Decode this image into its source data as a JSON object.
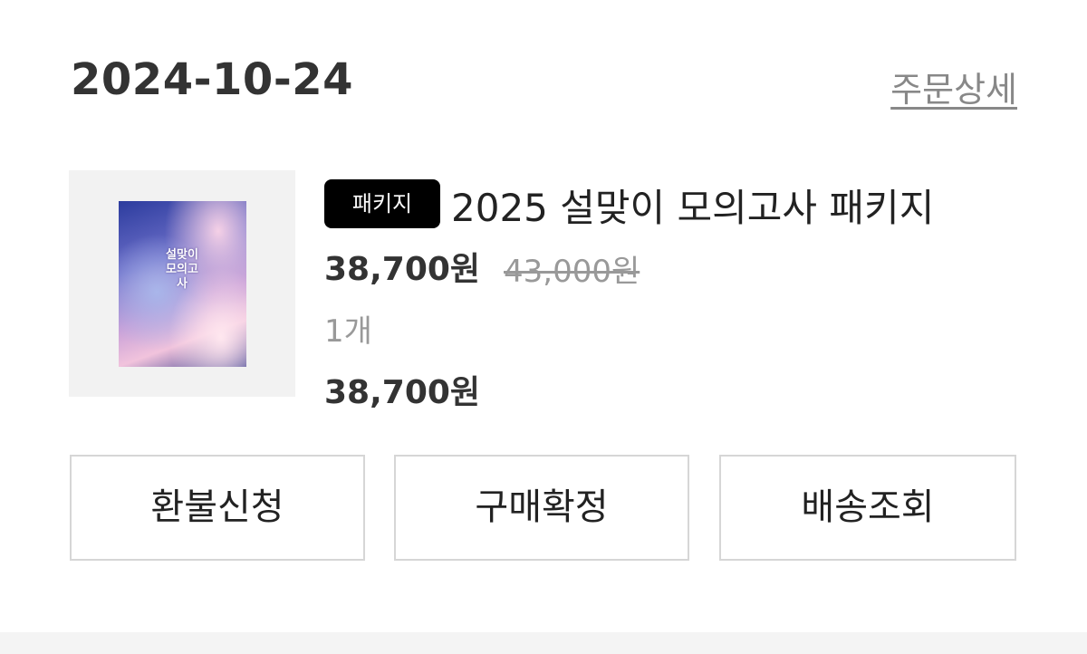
{
  "order": {
    "date": "2024-10-24",
    "detail_link": "주문상세"
  },
  "item": {
    "badge": "패키지",
    "title": "2025 설맞이 모의고사 패키지",
    "price": "38,700원",
    "original_price": "43,000원",
    "quantity": "1개",
    "total": "38,700원",
    "cover_text": "설맞이 모의고사"
  },
  "actions": {
    "refund_label": "환불신청",
    "confirm_label": "구매확정",
    "tracking_label": "배송조회"
  },
  "colors": {
    "badge_bg": "#000000",
    "muted_text": "#999999",
    "border": "#d6d6d6"
  }
}
